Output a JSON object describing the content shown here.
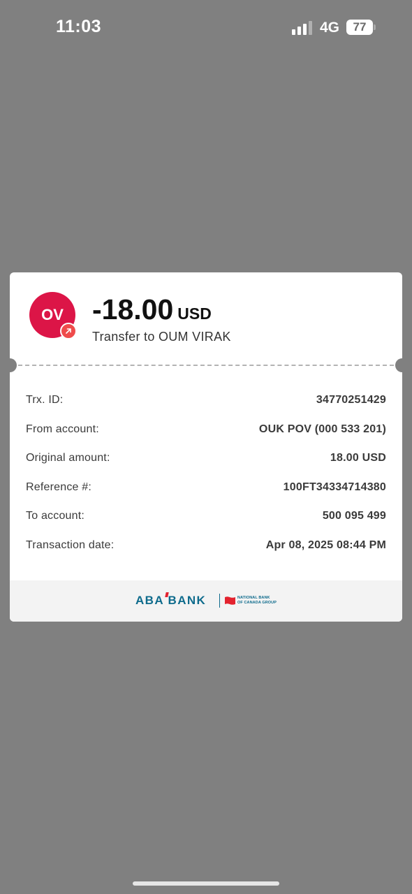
{
  "status_bar": {
    "time": "11:03",
    "network": "4G",
    "battery": "77",
    "signal_icon": "cellular-signal-icon"
  },
  "receipt": {
    "avatar_initials": "OV",
    "avatar_color": "#dc1547",
    "badge_icon": "arrow-up-right-icon",
    "amount": "-18.00",
    "currency": "USD",
    "subtitle": "Transfer to OUM VIRAK",
    "details": [
      {
        "label": "Trx. ID:",
        "value": "34770251429"
      },
      {
        "label": "From account:",
        "value": "OUK POV (000 533 201)"
      },
      {
        "label": "Original amount:",
        "value": "18.00 USD"
      },
      {
        "label": "Reference #:",
        "value": "100FT34334714380"
      },
      {
        "label": "To account:",
        "value": "500 095 499"
      },
      {
        "label": "Transaction date:",
        "value": "Apr 08, 2025 08:44 PM"
      }
    ]
  },
  "footer": {
    "brand": "ABA BANK",
    "partner_line1": "NATIONAL BANK",
    "partner_line2": "OF CANADA GROUP",
    "brand_color": "#0e6b8c",
    "accent_color": "#e3222e"
  }
}
